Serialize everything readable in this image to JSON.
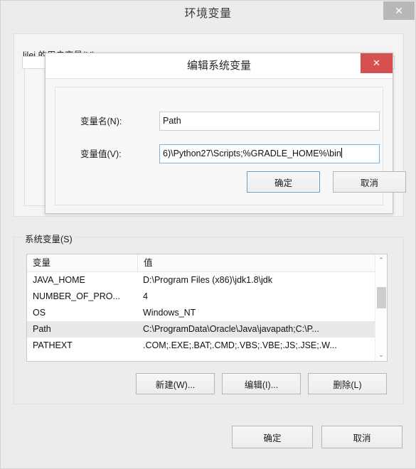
{
  "window": {
    "title": "环境变量",
    "close_label": "✕"
  },
  "user_group": {
    "legend": "lilei 的用户变量(U)"
  },
  "modal": {
    "title": "编辑系统变量",
    "close_label": "✕",
    "fields": {
      "name_label": "变量名(N):",
      "name_value": "Path",
      "value_label": "变量值(V):",
      "value_value": "6)\\Python27\\Scripts;%GRADLE_HOME%\\bin"
    },
    "ok_label": "确定",
    "cancel_label": "取消"
  },
  "system_group": {
    "legend": "系统变量(S)",
    "columns": [
      "变量",
      "值"
    ],
    "rows": [
      {
        "name": "JAVA_HOME",
        "value": "D:\\Program Files (x86)\\jdk1.8\\jdk",
        "selected": false
      },
      {
        "name": "NUMBER_OF_PRO...",
        "value": "4",
        "selected": false
      },
      {
        "name": "OS",
        "value": "Windows_NT",
        "selected": false
      },
      {
        "name": "Path",
        "value": "C:\\ProgramData\\Oracle\\Java\\javapath;C:\\P...",
        "selected": true
      },
      {
        "name": "PATHEXT",
        "value": ".COM;.EXE;.BAT;.CMD;.VBS;.VBE;.JS;.JSE;.W...",
        "selected": false
      }
    ],
    "scroll_up_label": "⌃",
    "scroll_down_label": "⌄",
    "new_label": "新建(W)...",
    "edit_label": "编辑(I)...",
    "delete_label": "删除(L)"
  },
  "footer": {
    "ok_label": "确定",
    "cancel_label": "取消"
  },
  "colors": {
    "window_bg": "#ececec",
    "modal_close_red": "#d6504f",
    "focus_blue": "#7eb4e2",
    "default_button_blue": "#5b9bd5",
    "selection_gray": "#e9e9e9"
  }
}
